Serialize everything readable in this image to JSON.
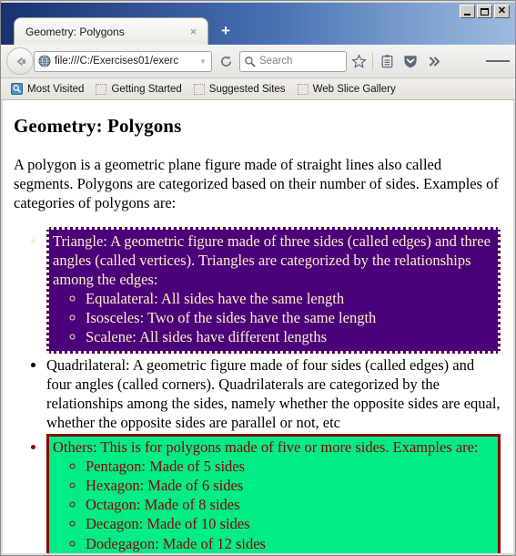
{
  "window": {
    "controls": {
      "minimize_label": "Minimize",
      "maximize_label": "Maximize",
      "close_label": "Close"
    }
  },
  "tabs": [
    {
      "title": "Geometry: Polygons",
      "close_label": "×",
      "active": true
    }
  ],
  "new_tab_label": "+",
  "navbar": {
    "back_label": "←",
    "url": "file:///C:/Exercises01/exerc",
    "url_dropdown_label": "▼",
    "reload_label": "↻",
    "search_placeholder": "Search",
    "bookmark_star_label": "Bookmark this page",
    "reading_list_label": "Reading list",
    "pocket_label": "Save to Pocket",
    "overflow_label": "»",
    "menu_label": "Open menu"
  },
  "bookmarks": [
    {
      "label": "Most Visited",
      "icon": "most-visited-icon"
    },
    {
      "label": "Getting Started",
      "icon": "placeholder-icon"
    },
    {
      "label": "Suggested Sites",
      "icon": "placeholder-icon"
    },
    {
      "label": "Web Slice Gallery",
      "icon": "placeholder-icon"
    }
  ],
  "page": {
    "title": "Geometry: Polygons",
    "intro": "A polygon is a geometric plane figure made of straight lines also called segments. Polygons are categorized based on their number of sides. Examples of categories of polygons are:",
    "categories": [
      {
        "id": "triangle",
        "style": "purple-box",
        "text": "Triangle: A geometric figure made of three sides (called edges) and three angles (called vertices). Triangles are categorized by the relationships among the edges:",
        "sub": [
          "Equalateral: All sides have the same length",
          "Isosceles: Two of the sides have the same length",
          "Scalene: All sides have different lengths"
        ],
        "colors": {
          "background": "#4b0179",
          "text": "#ffeecb",
          "border": "#ffeecb"
        }
      },
      {
        "id": "quadrilateral",
        "style": "plain",
        "text": "Quadrilateral: A geometric figure made of four sides (called edges) and four angles (called corners). Quadrilaterals are categorized by the relationships among the sides, namely whether the opposite sides are equal, whether the opposite sides are parallel or not, etc",
        "sub": [],
        "colors": {
          "background": "#ffffff",
          "text": "#000000",
          "border": ""
        }
      },
      {
        "id": "others",
        "style": "green-box",
        "text": "Others: This is for polygons made of five or more sides. Examples are:",
        "sub": [
          "Pentagon: Made of 5 sides",
          "Hexagon: Made of 6 sides",
          "Octagon: Made of 8 sides",
          "Decagon: Made of 10 sides",
          "Dodegagon: Made of 12 sides"
        ],
        "colors": {
          "background": "#00ec87",
          "text": "#8b0000",
          "border": "#8b0000"
        }
      }
    ]
  }
}
